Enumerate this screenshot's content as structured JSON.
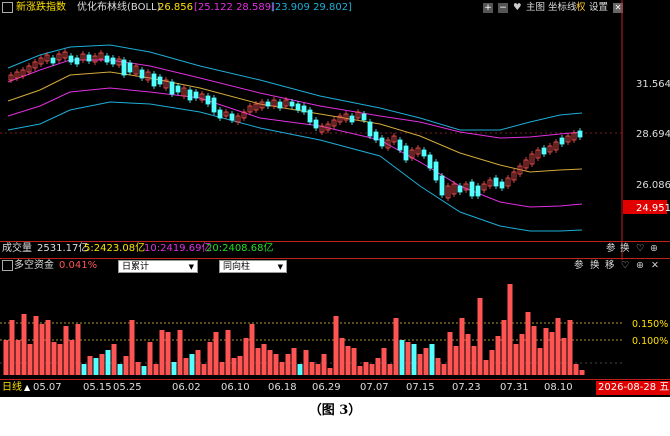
{
  "top_bar": {
    "title": "新涨跌指数",
    "indicator": "优化布林线(BOLL)",
    "mid_value": "26.856",
    "upper_range": "[25.122 28.589]",
    "lower_range": "[23.909 29.802]",
    "buttons": {
      "plus": "+",
      "minus": "−",
      "heart": "♥",
      "main": "主图",
      "axis": "坐标线",
      "right": "权",
      "settings": "设置"
    }
  },
  "price_axis": {
    "labels": [
      "31.564",
      "28.694",
      "26.086"
    ],
    "current": "24.951"
  },
  "volume_bar": {
    "label": "成交量",
    "total": "2531.17亿",
    "ma5": "5:2423.08亿",
    "ma10": "10:2419.69亿",
    "ma20": "20:2408.68亿",
    "buttons": [
      "参",
      "换"
    ]
  },
  "capital_bar": {
    "label": "多空资金",
    "value": "0.041%",
    "select1": "日累计",
    "select2": "同向柱",
    "buttons": [
      "参",
      "换",
      "移"
    ]
  },
  "capital_axis": {
    "labels": [
      "0.150%",
      "0.100%"
    ]
  },
  "date_axis": {
    "period": "日线",
    "dates": [
      "05.07",
      "05.15",
      "05.25",
      "06.02",
      "06.10",
      "06.18",
      "06.29",
      "07.07",
      "07.15",
      "07.23",
      "07.31",
      "08.10"
    ],
    "current_date": "2026-08-28 五"
  },
  "caption": "（图 3）",
  "colors": {
    "up": "#ff5454",
    "down": "#54ffff",
    "mid": "#d4aa3a",
    "upper": "#e030e0",
    "outer": "#1eaed8",
    "background": "#000000"
  }
}
